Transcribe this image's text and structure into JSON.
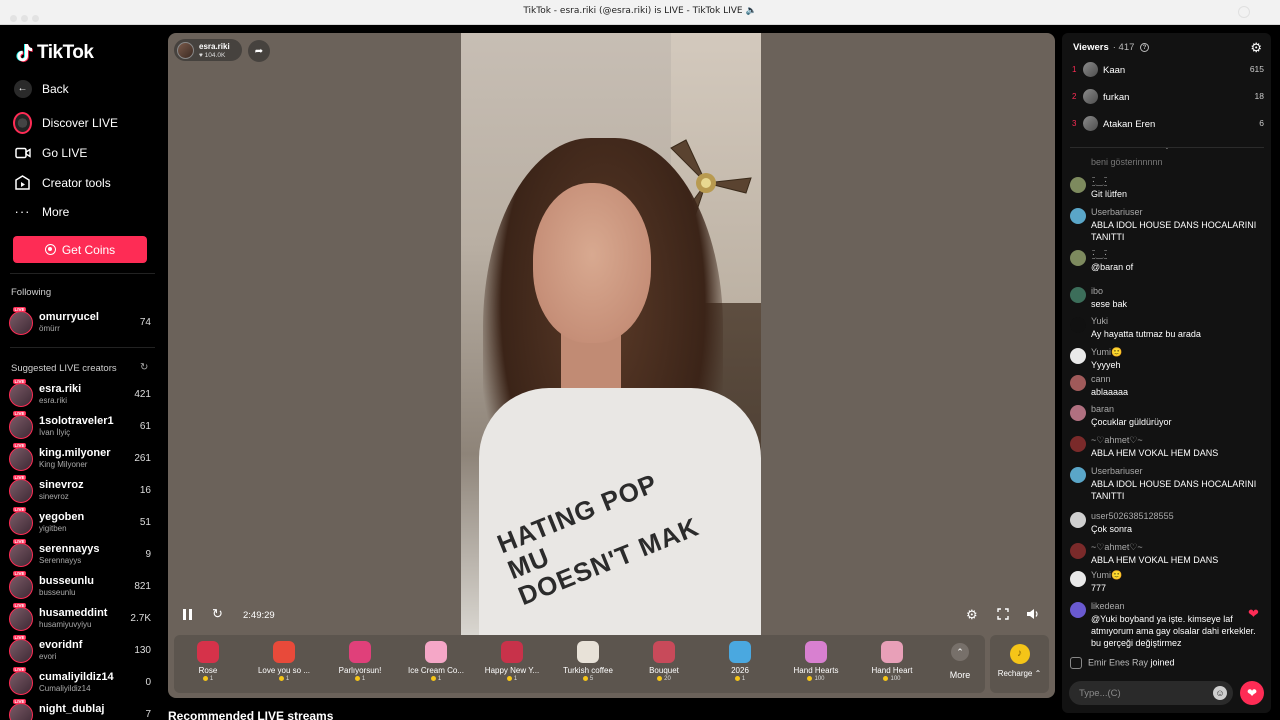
{
  "window": {
    "title": "TikTok - esra.riki (@esra.riki) is LIVE - TikTok LIVE 🔈"
  },
  "sidebar": {
    "logo": "TikTok",
    "nav": [
      {
        "label": "Back",
        "icon": "back-arrow-icon"
      },
      {
        "label": "Discover LIVE",
        "icon": "discover-live-icon"
      },
      {
        "label": "Go LIVE",
        "icon": "video-camera-icon"
      },
      {
        "label": "Creator tools",
        "icon": "creator-tools-icon"
      },
      {
        "label": "More",
        "icon": "more-dots-icon"
      }
    ],
    "get_coins": "Get Coins",
    "following_label": "Following",
    "following": [
      {
        "name": "omurryucel",
        "sub": "ömürr",
        "count": "74"
      }
    ],
    "suggested_label": "Suggested LIVE creators",
    "live_tag": "LIVE",
    "suggested": [
      {
        "name": "esra.riki",
        "sub": "esra.riki",
        "count": "421"
      },
      {
        "name": "1solotraveler1",
        "sub": "İvan İlyiç",
        "count": "61"
      },
      {
        "name": "king.milyoner",
        "sub": "King Milyoner",
        "count": "261"
      },
      {
        "name": "sinevroz",
        "sub": "sinevroz",
        "count": "16"
      },
      {
        "name": "yegoben",
        "sub": "yigitben",
        "count": "51"
      },
      {
        "name": "serennayys",
        "sub": "Serennayys",
        "count": "9"
      },
      {
        "name": "busseunlu",
        "sub": "busseunlu",
        "count": "821"
      },
      {
        "name": "husameddint",
        "sub": "husamiyuvyiyu",
        "count": "2.7K"
      },
      {
        "name": "evoridnf",
        "sub": "evori",
        "count": "130"
      },
      {
        "name": "cumaliyildiz14",
        "sub": "Cumaliyildiz14",
        "count": "0"
      },
      {
        "name": "night_dublaj",
        "sub": "",
        "count": "7"
      }
    ]
  },
  "player": {
    "host_name": "esra.riki",
    "host_likes": "104.0K",
    "shirt_text": "HATING POP MU\nDOESN'T MAK",
    "timecode": "2:49:29",
    "gifts": [
      {
        "name": "Rose",
        "price": "1",
        "color": "#d6324a"
      },
      {
        "name": "Love you so ...",
        "price": "1",
        "color": "#e84a3a"
      },
      {
        "name": "Parlıyorsun!",
        "price": "1",
        "color": "#e0407a"
      },
      {
        "name": "Ice Cream Co...",
        "price": "1",
        "color": "#f5a7c7"
      },
      {
        "name": "Happy New Y...",
        "price": "1",
        "color": "#c8324a"
      },
      {
        "name": "Turkish coffee",
        "price": "5",
        "color": "#e8e2d8"
      },
      {
        "name": "Bouquet",
        "price": "20",
        "color": "#c84a5a"
      },
      {
        "name": "2026",
        "price": "1",
        "color": "#4aa8e0"
      },
      {
        "name": "Hand Hearts",
        "price": "100",
        "color": "#d880d0"
      },
      {
        "name": "Hand Heart",
        "price": "100",
        "color": "#e8a0b8"
      }
    ],
    "more_label": "More",
    "recharge_label": "Recharge ⌃"
  },
  "recommended_title": "Recommended LIVE streams",
  "viewers": {
    "label": "Viewers",
    "count": "· 417",
    "top": [
      {
        "rank": "1",
        "name": "Kaan",
        "score": "615"
      },
      {
        "rank": "2",
        "name": "furkan",
        "score": "18"
      },
      {
        "rank": "3",
        "name": "Atakan Eren",
        "score": "6"
      }
    ]
  },
  "chat": {
    "faded": "beni gösterinnnnn",
    "messages": [
      {
        "user": "٠̮̑‿٠̮̑",
        "text": "Git lütfen"
      },
      {
        "user": "Userbariuser",
        "text": "ABLA IDOL HOUSE DANS HOCALARINI TANITTI"
      },
      {
        "user": "٠̮̑‿٠̮̑",
        "text": "@baran of"
      },
      {
        "user": "ibo",
        "text": "sese bak"
      },
      {
        "user": "Yuki",
        "text": "Ay hayatta tutmaz bu arada"
      },
      {
        "user": "Yumi🙂",
        "text": "Yyyyeh"
      },
      {
        "user": "cann",
        "text": "ablaaaaa"
      },
      {
        "user": "baran",
        "text": "Çocuklar güldürüyor"
      },
      {
        "user": "~♡ahmet♡~",
        "text": "ABLA HEM VOKAL HEM DANS"
      },
      {
        "user": "Userbariuser",
        "text": "ABLA IDOL HOUSE DANS HOCALARINI TANITTI"
      },
      {
        "user": "user5026385128555",
        "text": "Çok sonra"
      },
      {
        "user": "~♡ahmet♡~",
        "text": "ABLA HEM VOKAL HEM DANS"
      },
      {
        "user": "Yumi🙂",
        "text": "777"
      },
      {
        "user": "likedean",
        "text": "@Yuki boyband ya işte. kimseye laf atmıyorum ama gay olsalar dahi erkekler. bu gerçeği değiştirmez"
      }
    ],
    "joined_user": "Emir Enes Ray",
    "joined_text": "joined",
    "input_placeholder": "Type...(C)"
  },
  "colors": {
    "accent": "#fe2c55",
    "coin": "#f5c518"
  }
}
